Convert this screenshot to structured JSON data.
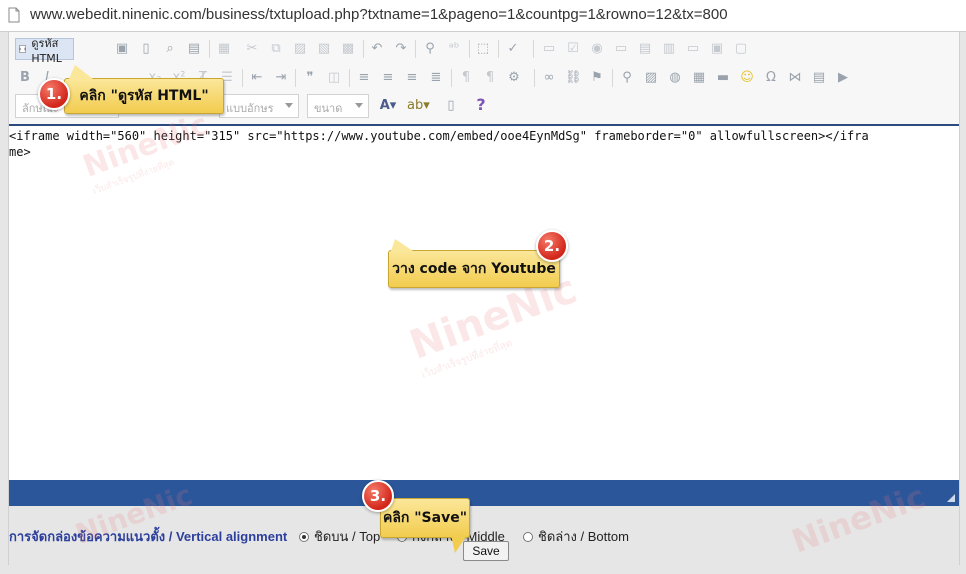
{
  "url": "www.webedit.ninenic.com/business/txtupload.php?txtname=1&pageno=1&countpg=1&rowno=12&tx=800",
  "toolbar": {
    "source_label": "ดูรหัส HTML",
    "style_combo": "ลักษณะ",
    "font_combo": "แบบอักษร",
    "size_combo": "ขนาด",
    "help_glyph": "?"
  },
  "source_code": {
    "line1": "<iframe width=\"560\" height=\"315\" src=\"https://www.youtube.com/embed/ooe4EynMdSg\" frameborder=\"0\" allowfullscreen></ifra",
    "line2": "me>"
  },
  "alignment": {
    "label": "การจัดกล่องข้อความแนวตั้ง / Vertical alignment",
    "options": [
      {
        "label": "ชิดบน / Top",
        "selected": true
      },
      {
        "label": "กึ่งกลาง / Middle",
        "selected": false
      },
      {
        "label": "ชิดล่าง / Bottom",
        "selected": false
      }
    ]
  },
  "save_label": "Save",
  "callouts": [
    {
      "num": "1.",
      "text": "คลิก \"ดูรหัส HTML\""
    },
    {
      "num": "2.",
      "text": "วาง code จาก Youtube"
    },
    {
      "num": "3.",
      "text": "คลิก \"Save\""
    }
  ],
  "watermark": {
    "text": "NineNic",
    "sub": "เว็บสำเร็จรูปที่ง่ายที่สุด"
  },
  "colors": {
    "accent_blue": "#2b569a",
    "label_blue": "#2c3f9c",
    "callout_yellow": "#f2cc4e",
    "badge_red": "#d2261a"
  }
}
